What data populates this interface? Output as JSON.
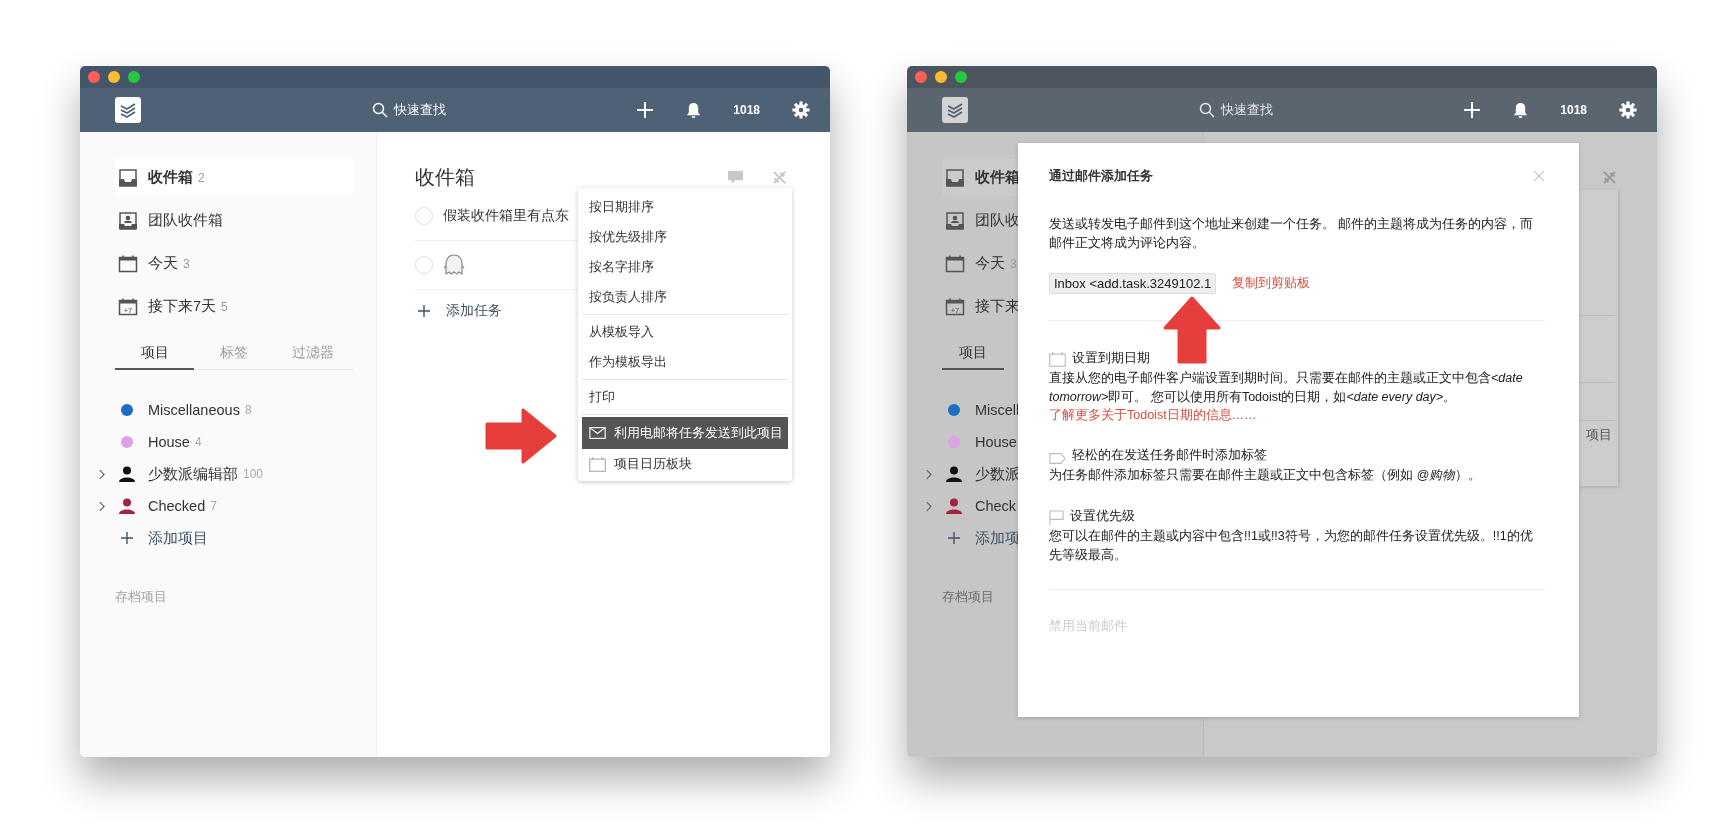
{
  "left_window": {
    "header": {
      "search_placeholder": "快速查找",
      "karma": "1018"
    },
    "sidebar": {
      "filters": [
        {
          "label": "收件箱",
          "count": "2",
          "kind": "inbox",
          "selected": true
        },
        {
          "label": "团队收件箱",
          "kind": "team_inbox",
          "selected": false
        },
        {
          "label": "今天",
          "count": "3",
          "kind": "calendar",
          "selected": false
        },
        {
          "label": "接下来7天",
          "count": "5",
          "kind": "calendar_plus",
          "icon_text": "+7",
          "selected": false
        }
      ],
      "tabs": [
        {
          "label": "项目",
          "selected": true
        },
        {
          "label": "标签",
          "selected": false
        },
        {
          "label": "过滤器",
          "selected": false
        }
      ],
      "projects": [
        {
          "label": "Miscellaneous",
          "count": "8",
          "kind": "dot",
          "color": "#1b6ec2",
          "expandable": false
        },
        {
          "label": "House",
          "count": "4",
          "kind": "dot",
          "color": "#dba3e3",
          "expandable": false
        },
        {
          "label": "少数派编辑部",
          "count": "100",
          "kind": "person",
          "color": "#111111",
          "expandable": true
        },
        {
          "label": "Checked",
          "count": "7",
          "kind": "person",
          "color": "#a3223c",
          "expandable": true
        }
      ],
      "add_project": "添加项目",
      "archived": "存档项目"
    },
    "main": {
      "title": "收件箱",
      "tasks": [
        {
          "kind": "text",
          "text": "假装收件箱里有点东",
          "checked": false
        },
        {
          "kind": "ghost",
          "checked": false
        }
      ],
      "add_task": "添加任务"
    },
    "menu": {
      "groups": [
        [
          {
            "label": "按日期排序",
            "kind": "plain",
            "selected": false
          },
          {
            "label": "按优先级排序",
            "kind": "plain",
            "selected": false
          },
          {
            "label": "按名字排序",
            "kind": "plain",
            "selected": false
          },
          {
            "label": "按负责人排序",
            "kind": "plain",
            "selected": false
          }
        ],
        [
          {
            "label": "从模板导入",
            "kind": "plain",
            "selected": false
          },
          {
            "label": "作为模板导出",
            "kind": "plain",
            "selected": false
          }
        ],
        [
          {
            "label": "打印",
            "kind": "plain",
            "selected": false
          }
        ],
        [
          {
            "label": "利用电邮将任务发送到此项目",
            "kind": "mail",
            "selected": true
          },
          {
            "label": "项目日历板块",
            "kind": "calendar",
            "selected": false
          }
        ]
      ]
    }
  },
  "right_window": {
    "header": {
      "search_placeholder": "快速查找",
      "karma": "1018"
    },
    "sidebar": {
      "filters": [
        {
          "label": "收件箱",
          "kind": "inbox",
          "selected": true
        },
        {
          "label": "团队收",
          "kind": "team_inbox",
          "selected": false
        },
        {
          "label": "今天",
          "count": "3",
          "kind": "calendar",
          "selected": false
        },
        {
          "label": "接下来",
          "kind": "calendar_plus",
          "icon_text": "+7",
          "selected": false
        }
      ],
      "tabs": [
        {
          "label": "项目",
          "selected": true
        }
      ],
      "projects": [
        {
          "label": "Miscell",
          "kind": "dot",
          "color": "#1b6ec2",
          "expandable": false
        },
        {
          "label": "House",
          "kind": "dot",
          "color": "#dba3e3",
          "expandable": false
        },
        {
          "label": "少数派",
          "kind": "person",
          "color": "#111111",
          "expandable": true
        },
        {
          "label": "Check",
          "kind": "person",
          "color": "#a3223c",
          "expandable": true
        }
      ],
      "add_project": "添加项",
      "archived": "存档项目"
    },
    "menu_fragment": {
      "label": "项目"
    },
    "modal": {
      "title": "通过邮件添加任务",
      "description": "发送或转发电子邮件到这个地址来创建一个任务。 邮件的主题将成为任务的内容，而邮件正文将成为评论内容。",
      "address": "Inbox <add.task.3249102.1",
      "copy_link": "复制到剪贴板",
      "sections": [
        {
          "kind": "date",
          "heading": "设置到期日期",
          "parts": [
            {
              "text": "直接从您的电子邮件客户端设置到期时间。只需要在邮件的主题或正文中包含",
              "italic": false
            },
            {
              "text": "<date tomorrow>",
              "italic": true
            },
            {
              "text": "即可。 您可以使用所有Todoist的日期，如",
              "italic": false
            },
            {
              "text": "<date every day>",
              "italic": true
            },
            {
              "text": "。",
              "italic": false
            }
          ],
          "link": "了解更多关于Todoist日期的信息……"
        },
        {
          "kind": "label",
          "heading": "轻松的在发送任务邮件时添加标签",
          "parts": [
            {
              "text": "为任务邮件添加标签只需要在邮件主题或正文中包含标签（例如 ",
              "italic": false
            },
            {
              "text": "@购物",
              "italic": true
            },
            {
              "text": "）。",
              "italic": false
            }
          ]
        },
        {
          "kind": "priority",
          "heading": "设置优先级",
          "parts": [
            {
              "text": "您可以在邮件的主题或内容中包含!!1或!!3符号，为您的邮件任务设置优先级。!!1的优先等级最高。",
              "italic": false
            }
          ]
        }
      ],
      "disable_link": "禁用当前邮件"
    }
  }
}
